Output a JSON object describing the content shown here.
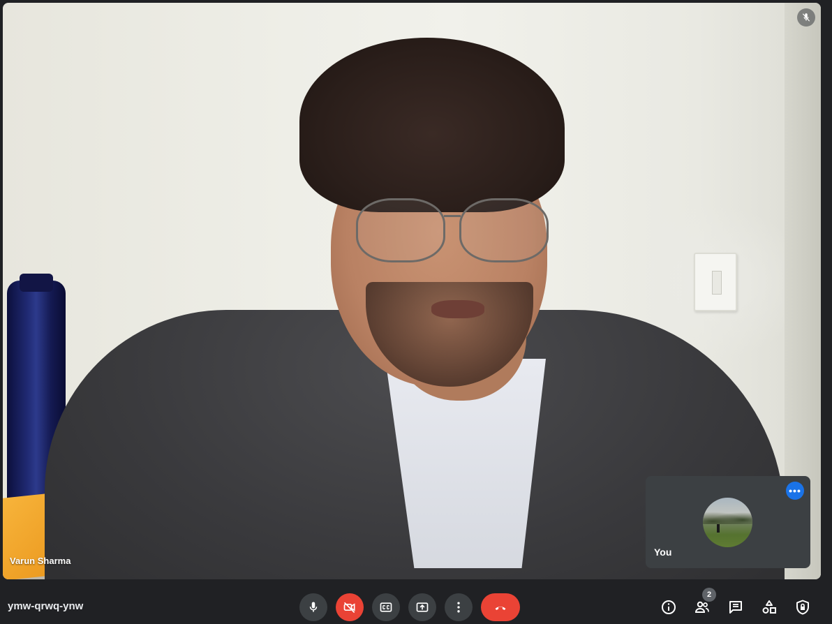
{
  "main_participant": {
    "name": "Varun Sharma",
    "muted": true
  },
  "self_view": {
    "label": "You",
    "more_label": "•••"
  },
  "meeting": {
    "code": "ymw-qrwq-ynw",
    "participant_count": "2"
  },
  "controls": {
    "mic": "microphone-icon",
    "camera": "camera-off-icon",
    "captions": "captions-icon",
    "present": "present-screen-icon",
    "more": "more-vert-icon",
    "leave": "call-end-icon"
  },
  "right_controls": [
    "info-icon",
    "people-icon",
    "chat-icon",
    "activities-icon",
    "host-controls-icon"
  ],
  "colors": {
    "bar": "#202124",
    "button": "#3c4043",
    "danger": "#ea4335",
    "accent": "#1a73e8"
  }
}
